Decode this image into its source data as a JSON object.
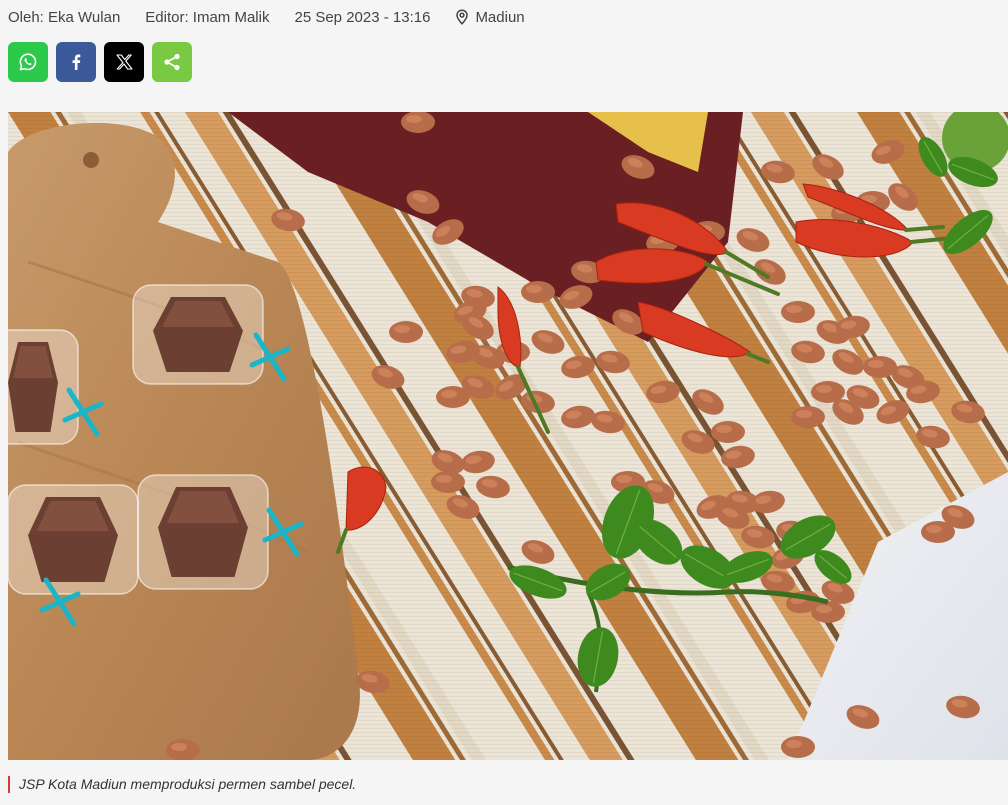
{
  "meta": {
    "author": "Oleh: Eka Wulan",
    "editor": "Editor: Imam Malik",
    "datetime": "25 Sep 2023 - 13:16",
    "location": "Madiun"
  },
  "share": {
    "buttons": [
      {
        "name": "whatsapp",
        "color": "#2dc94a"
      },
      {
        "name": "facebook",
        "color": "#3c5a9a"
      },
      {
        "name": "x",
        "color": "#000000"
      },
      {
        "name": "share",
        "color": "#7ac943"
      }
    ]
  },
  "photo": {
    "subject": "wrapped sambel pecel candies, peanuts, chilies and lime leaves on striped placemat"
  },
  "caption": "JSP Kota Madiun memproduksi permen sambel pecel."
}
